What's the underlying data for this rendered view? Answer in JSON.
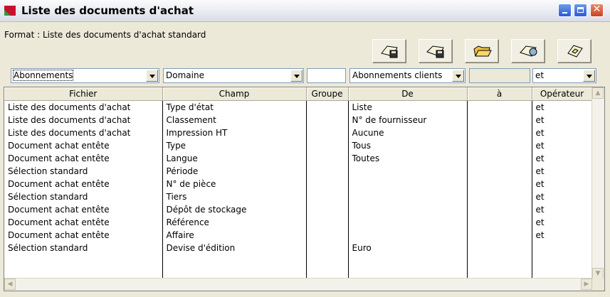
{
  "window": {
    "title": "Liste des documents d'achat",
    "controls": {
      "minimize": "minimize-icon",
      "maximize": "maximize-icon",
      "close": "close-icon"
    }
  },
  "format": {
    "label": "Format : Liste des documents d'achat standard"
  },
  "toolbar": {
    "icons": [
      "save-format-icon",
      "save-as-format-icon",
      "open-format-icon",
      "format-settings-icon",
      "format-options-icon"
    ]
  },
  "filters": {
    "fichier": "Abonnements",
    "champ": "Domaine",
    "groupe": "",
    "de": "Abonnements clients",
    "a": "",
    "operateur": "et"
  },
  "table": {
    "columns": [
      "Fichier",
      "Champ",
      "Groupe",
      "De",
      "à",
      "Opérateur"
    ],
    "rows": [
      [
        "Liste des documents d'achat",
        "Type d'état",
        "",
        "Liste",
        "",
        "et"
      ],
      [
        "Liste des documents d'achat",
        "Classement",
        "",
        "N° de fournisseur",
        "",
        "et"
      ],
      [
        "Liste des documents d'achat",
        "Impression HT",
        "",
        "Aucune",
        "",
        "et"
      ],
      [
        "Document achat entête",
        "Type",
        "",
        "Tous",
        "",
        "et"
      ],
      [
        "Document achat entête",
        "Langue",
        "",
        "Toutes",
        "",
        "et"
      ],
      [
        "Sélection standard",
        "Période",
        "",
        "",
        "",
        "et"
      ],
      [
        "Document achat entête",
        "N° de pièce",
        "",
        "",
        "",
        "et"
      ],
      [
        "Sélection standard",
        "Tiers",
        "",
        "",
        "",
        "et"
      ],
      [
        "Document achat entête",
        "Dépôt de stockage",
        "",
        "",
        "",
        "et"
      ],
      [
        "Document achat entête",
        "Référence",
        "",
        "",
        "",
        "et"
      ],
      [
        "Document achat entête",
        "Affaire",
        "",
        "",
        "",
        "et"
      ],
      [
        "Sélection standard",
        "Devise d'édition",
        "",
        "Euro",
        "",
        ""
      ]
    ]
  }
}
